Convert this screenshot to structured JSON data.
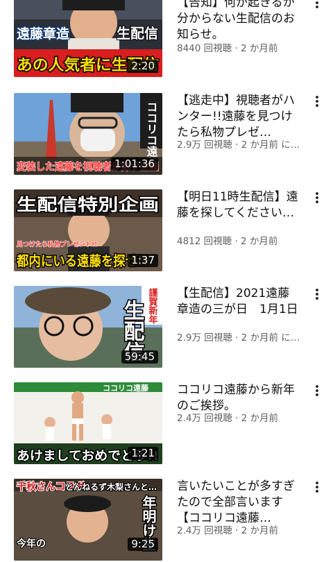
{
  "videos": [
    {
      "title": "【告知】何が起きるか分からない生配信のお知らせ。",
      "meta": "8440 回視聴 · 2 か月前",
      "duration": "2:20",
      "thumb_lines": [
        "遠藤章造",
        "生配信",
        "あの人気者に生配信"
      ]
    },
    {
      "title": "【逃走中】視聴者がハンター!!遠藤を見つけたら私物プレゼ…",
      "meta": "2.9万 回視聴 · 2 か月前 に…",
      "duration": "1:01:36",
      "thumb_lines": [
        "ココリコ遠藤",
        "変装した遠藤を視聴者が探す企画"
      ]
    },
    {
      "title": "【明日11時生配信】遠藤を探してください…",
      "meta": "4812 回視聴 · 2 か月前",
      "duration": "1:37",
      "thumb_lines": [
        "生配信特別企画",
        "見つけたら私物プレゼント!!",
        "都内にいる遠藤を探せ!!"
      ]
    },
    {
      "title": "【生配信】2021遠藤章造の三が日　1月1日",
      "meta": "2.9万 回視聴 · 2 か月前 に…",
      "duration": "59:45",
      "thumb_lines": [
        "謹賀新年",
        "生配信"
      ]
    },
    {
      "title": "ココリコ遠藤から新年のご挨拶。",
      "meta": "2.4万 回視聴 · 2 か月前",
      "duration": "1:21",
      "thumb_lines": [
        "ココリコ遠藤",
        "あけましておめでとう!!"
      ]
    },
    {
      "title": "言いたいことが多すぎたので全部言います【ココリコ遠藤…",
      "meta": "2.4万 回視聴 · 2 か月前",
      "duration": "9:25",
      "thumb_lines": [
        "千秋さんコラボ",
        "とんねるず木梨さんと…",
        "年明け生",
        "今年の"
      ]
    }
  ],
  "colors": {
    "title": "#0f0f0f",
    "meta": "#606060",
    "duration_bg": "#000000",
    "thumb_red": "#d81e1e",
    "thumb_yellow": "#ffe100"
  },
  "icons": {
    "menu": "more-vert-icon"
  }
}
